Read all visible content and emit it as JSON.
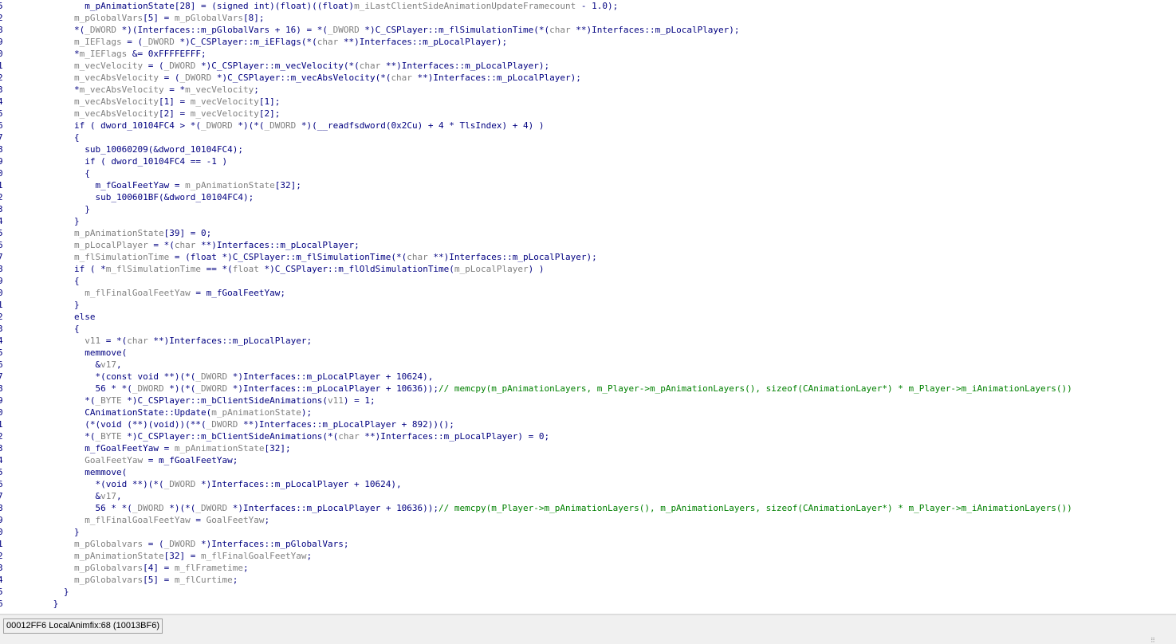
{
  "editor": {
    "lines": [
      {
        "ln": "5",
        "indent": 17,
        "segs": [
          [
            "p",
            "m_pAnimationState[28] = (signed int)(float)((float)"
          ],
          [
            "g",
            "m_iLastClientSideAnimationUpdateFramecount"
          ],
          [
            "p",
            " - 1.0);"
          ]
        ]
      },
      {
        "ln": "2",
        "indent": 15,
        "segs": [
          [
            "g",
            "m_pGlobalVars"
          ],
          [
            "p",
            "[5] = "
          ],
          [
            "g",
            "m_pGlobalVars"
          ],
          [
            "p",
            "[8];"
          ]
        ]
      },
      {
        "ln": "8",
        "indent": 15,
        "segs": [
          [
            "p",
            "*("
          ],
          [
            "g",
            "_DWORD"
          ],
          [
            "p",
            " *)(Interfaces::m_pGlobalVars + 16) = *("
          ],
          [
            "g",
            "_DWORD"
          ],
          [
            "p",
            " *)C_CSPlayer::m_flSimulationTime(*("
          ],
          [
            "g",
            "char"
          ],
          [
            "p",
            " **)Interfaces::m_pLocalPlayer);"
          ]
        ]
      },
      {
        "ln": "9",
        "indent": 15,
        "segs": [
          [
            "g",
            "m_IEFlags"
          ],
          [
            "p",
            " = ("
          ],
          [
            "g",
            "_DWORD"
          ],
          [
            "p",
            " *)C_CSPlayer::m_iEFlags(*("
          ],
          [
            "g",
            "char"
          ],
          [
            "p",
            " **)Interfaces::m_pLocalPlayer);"
          ]
        ]
      },
      {
        "ln": "0",
        "indent": 15,
        "segs": [
          [
            "p",
            "*"
          ],
          [
            "g",
            "m_IEFlags"
          ],
          [
            "p",
            " &= 0xFFFFEFFF;"
          ]
        ]
      },
      {
        "ln": "1",
        "indent": 15,
        "segs": [
          [
            "g",
            "m_vecVelocity"
          ],
          [
            "p",
            " = ("
          ],
          [
            "g",
            "_DWORD"
          ],
          [
            "p",
            " *)C_CSPlayer::m_vecVelocity(*("
          ],
          [
            "g",
            "char"
          ],
          [
            "p",
            " **)Interfaces::m_pLocalPlayer);"
          ]
        ]
      },
      {
        "ln": "2",
        "indent": 15,
        "segs": [
          [
            "g",
            "m_vecAbsVelocity"
          ],
          [
            "p",
            " = ("
          ],
          [
            "g",
            "_DWORD"
          ],
          [
            "p",
            " *)C_CSPlayer::m_vecAbsVelocity(*("
          ],
          [
            "g",
            "char"
          ],
          [
            "p",
            " **)Interfaces::m_pLocalPlayer);"
          ]
        ]
      },
      {
        "ln": "3",
        "indent": 15,
        "segs": [
          [
            "p",
            "*"
          ],
          [
            "g",
            "m_vecAbsVelocity"
          ],
          [
            "p",
            " = *"
          ],
          [
            "g",
            "m_vecVelocity"
          ],
          [
            "p",
            ";"
          ]
        ]
      },
      {
        "ln": "4",
        "indent": 15,
        "segs": [
          [
            "g",
            "m_vecAbsVelocity"
          ],
          [
            "p",
            "[1] = "
          ],
          [
            "g",
            "m_vecVelocity"
          ],
          [
            "p",
            "[1];"
          ]
        ]
      },
      {
        "ln": "5",
        "indent": 15,
        "segs": [
          [
            "g",
            "m_vecAbsVelocity"
          ],
          [
            "p",
            "[2] = "
          ],
          [
            "g",
            "m_vecVelocity"
          ],
          [
            "p",
            "[2];"
          ]
        ]
      },
      {
        "ln": "6",
        "indent": 15,
        "segs": [
          [
            "p",
            "if ( dword_10104FC4 > *("
          ],
          [
            "g",
            "_DWORD"
          ],
          [
            "p",
            " *)(*("
          ],
          [
            "g",
            "_DWORD"
          ],
          [
            "p",
            " *)(__readfsdword(0x2Cu) + 4 * TlsIndex) + 4) )"
          ]
        ]
      },
      {
        "ln": "7",
        "indent": 15,
        "segs": [
          [
            "p",
            "{"
          ]
        ]
      },
      {
        "ln": "8",
        "indent": 17,
        "segs": [
          [
            "p",
            "sub_10060209(&dword_10104FC4);"
          ]
        ]
      },
      {
        "ln": "9",
        "indent": 17,
        "segs": [
          [
            "p",
            "if ( dword_10104FC4 == -1 )"
          ]
        ]
      },
      {
        "ln": "0",
        "indent": 17,
        "segs": [
          [
            "p",
            "{"
          ]
        ]
      },
      {
        "ln": "1",
        "indent": 19,
        "segs": [
          [
            "p",
            "m_fGoalFeetYaw = "
          ],
          [
            "g",
            "m_pAnimationState"
          ],
          [
            "p",
            "[32];"
          ]
        ]
      },
      {
        "ln": "2",
        "indent": 19,
        "segs": [
          [
            "p",
            "sub_100601BF(&dword_10104FC4);"
          ]
        ]
      },
      {
        "ln": "3",
        "indent": 17,
        "segs": [
          [
            "p",
            "}"
          ]
        ]
      },
      {
        "ln": "4",
        "indent": 15,
        "segs": [
          [
            "p",
            "}"
          ]
        ]
      },
      {
        "ln": "5",
        "indent": 15,
        "segs": [
          [
            "g",
            "m_pAnimationState"
          ],
          [
            "p",
            "[39] = 0;"
          ]
        ]
      },
      {
        "ln": "6",
        "indent": 15,
        "segs": [
          [
            "g",
            "m_pLocalPlayer"
          ],
          [
            "p",
            " = *("
          ],
          [
            "g",
            "char"
          ],
          [
            "p",
            " **)Interfaces::m_pLocalPlayer;"
          ]
        ]
      },
      {
        "ln": "7",
        "indent": 15,
        "segs": [
          [
            "g",
            "m_flSimulationTime"
          ],
          [
            "p",
            " = (float *)C_CSPlayer::m_flSimulationTime(*("
          ],
          [
            "g",
            "char"
          ],
          [
            "p",
            " **)Interfaces::m_pLocalPlayer);"
          ]
        ]
      },
      {
        "ln": "8",
        "indent": 15,
        "segs": [
          [
            "p",
            "if ( *"
          ],
          [
            "g",
            "m_flSimulationTime"
          ],
          [
            "p",
            " == *("
          ],
          [
            "g",
            "float"
          ],
          [
            "p",
            " *)C_CSPlayer::m_flOldSimulationTime("
          ],
          [
            "g",
            "m_pLocalPlayer"
          ],
          [
            "p",
            ") )"
          ]
        ]
      },
      {
        "ln": "9",
        "indent": 15,
        "segs": [
          [
            "p",
            "{"
          ]
        ]
      },
      {
        "ln": "0",
        "indent": 17,
        "segs": [
          [
            "g",
            "m_flFinalGoalFeetYaw"
          ],
          [
            "p",
            " = m_fGoalFeetYaw;"
          ]
        ]
      },
      {
        "ln": "1",
        "indent": 15,
        "segs": [
          [
            "p",
            "}"
          ]
        ]
      },
      {
        "ln": "2",
        "indent": 15,
        "segs": [
          [
            "p",
            "else"
          ]
        ]
      },
      {
        "ln": "3",
        "indent": 15,
        "segs": [
          [
            "p",
            "{"
          ]
        ]
      },
      {
        "ln": "4",
        "indent": 17,
        "segs": [
          [
            "g",
            "v11"
          ],
          [
            "p",
            " = *("
          ],
          [
            "g",
            "char"
          ],
          [
            "p",
            " **)Interfaces::m_pLocalPlayer;"
          ]
        ]
      },
      {
        "ln": "5",
        "indent": 17,
        "segs": [
          [
            "p",
            "memmove("
          ]
        ]
      },
      {
        "ln": "6",
        "indent": 19,
        "segs": [
          [
            "p",
            "&"
          ],
          [
            "g",
            "v17"
          ],
          [
            "p",
            ","
          ]
        ]
      },
      {
        "ln": "7",
        "indent": 19,
        "segs": [
          [
            "p",
            "*(const void **)(*("
          ],
          [
            "g",
            "_DWORD"
          ],
          [
            "p",
            " *)Interfaces::m_pLocalPlayer + 10624),"
          ]
        ]
      },
      {
        "ln": "8",
        "indent": 19,
        "segs": [
          [
            "p",
            "56 * *("
          ],
          [
            "g",
            "_DWORD"
          ],
          [
            "p",
            " *)(*("
          ],
          [
            "g",
            "_DWORD"
          ],
          [
            "p",
            " *)Interfaces::m_pLocalPlayer + 10636));"
          ],
          [
            "c",
            "// memcpy(m_pAnimationLayers, m_Player->m_pAnimationLayers(), sizeof(CAnimationLayer*) * m_Player->m_iAnimationLayers())"
          ]
        ]
      },
      {
        "ln": "9",
        "indent": 17,
        "segs": [
          [
            "p",
            "*("
          ],
          [
            "g",
            "_BYTE"
          ],
          [
            "p",
            " *)C_CSPlayer::m_bClientSideAnimations("
          ],
          [
            "g",
            "v11"
          ],
          [
            "p",
            ") = 1;"
          ]
        ]
      },
      {
        "ln": "0",
        "indent": 17,
        "segs": [
          [
            "p",
            "CAnimationState::Update("
          ],
          [
            "g",
            "m_pAnimationState"
          ],
          [
            "p",
            ");"
          ]
        ]
      },
      {
        "ln": "1",
        "indent": 17,
        "segs": [
          [
            "p",
            "(*(void (**)(void))(**("
          ],
          [
            "g",
            "_DWORD"
          ],
          [
            "p",
            " **)Interfaces::m_pLocalPlayer + 892))();"
          ]
        ]
      },
      {
        "ln": "2",
        "indent": 17,
        "segs": [
          [
            "p",
            "*("
          ],
          [
            "g",
            "_BYTE"
          ],
          [
            "p",
            " *)C_CSPlayer::m_bClientSideAnimations(*("
          ],
          [
            "g",
            "char"
          ],
          [
            "p",
            " **)Interfaces::m_pLocalPlayer) = 0;"
          ]
        ]
      },
      {
        "ln": "3",
        "indent": 17,
        "segs": [
          [
            "p",
            "m_fGoalFeetYaw = "
          ],
          [
            "g",
            "m_pAnimationState"
          ],
          [
            "p",
            "[32];"
          ]
        ]
      },
      {
        "ln": "4",
        "indent": 17,
        "segs": [
          [
            "g",
            "GoalFeetYaw"
          ],
          [
            "p",
            " = m_fGoalFeetYaw;"
          ]
        ]
      },
      {
        "ln": "5",
        "indent": 17,
        "segs": [
          [
            "p",
            "memmove("
          ]
        ]
      },
      {
        "ln": "6",
        "indent": 19,
        "segs": [
          [
            "p",
            "*(void **)(*("
          ],
          [
            "g",
            "_DWORD"
          ],
          [
            "p",
            " *)Interfaces::m_pLocalPlayer + 10624),"
          ]
        ]
      },
      {
        "ln": "7",
        "indent": 19,
        "segs": [
          [
            "p",
            "&"
          ],
          [
            "g",
            "v17"
          ],
          [
            "p",
            ","
          ]
        ]
      },
      {
        "ln": "8",
        "indent": 19,
        "segs": [
          [
            "p",
            "56 * *("
          ],
          [
            "g",
            "_DWORD"
          ],
          [
            "p",
            " *)(*("
          ],
          [
            "g",
            "_DWORD"
          ],
          [
            "p",
            " *)Interfaces::m_pLocalPlayer + 10636));"
          ],
          [
            "c",
            "// memcpy(m_Player->m_pAnimationLayers(), m_pAnimationLayers, sizeof(CAnimationLayer*) * m_Player->m_iAnimationLayers())"
          ]
        ]
      },
      {
        "ln": "9",
        "indent": 17,
        "segs": [
          [
            "g",
            "m_flFinalGoalFeetYaw"
          ],
          [
            "p",
            " = "
          ],
          [
            "g",
            "GoalFeetYaw"
          ],
          [
            "p",
            ";"
          ]
        ]
      },
      {
        "ln": "0",
        "indent": 15,
        "segs": [
          [
            "p",
            "}"
          ]
        ]
      },
      {
        "ln": "1",
        "indent": 15,
        "segs": [
          [
            "g",
            "m_pGlobalvars"
          ],
          [
            "p",
            " = ("
          ],
          [
            "g",
            "_DWORD"
          ],
          [
            "p",
            " *)Interfaces::m_pGlobalVars;"
          ]
        ]
      },
      {
        "ln": "2",
        "indent": 15,
        "segs": [
          [
            "g",
            "m_pAnimationState"
          ],
          [
            "p",
            "[32] = "
          ],
          [
            "g",
            "m_flFinalGoalFeetYaw"
          ],
          [
            "p",
            ";"
          ]
        ]
      },
      {
        "ln": "3",
        "indent": 15,
        "segs": [
          [
            "g",
            "m_pGlobalvars"
          ],
          [
            "p",
            "[4] = "
          ],
          [
            "g",
            "m_flFrametime"
          ],
          [
            "p",
            ";"
          ]
        ]
      },
      {
        "ln": "4",
        "indent": 15,
        "segs": [
          [
            "g",
            "m_pGlobalvars"
          ],
          [
            "p",
            "[5] = "
          ],
          [
            "g",
            "m_flCurtime"
          ],
          [
            "p",
            ";"
          ]
        ]
      },
      {
        "ln": "5",
        "indent": 13,
        "segs": [
          [
            "p",
            "}"
          ]
        ]
      },
      {
        "ln": "6",
        "indent": 11,
        "segs": [
          [
            "p",
            "}"
          ]
        ]
      }
    ]
  },
  "statusbar": {
    "address": "00012FF6",
    "location": "LocalAnimfix:68 (10013BF6)"
  }
}
